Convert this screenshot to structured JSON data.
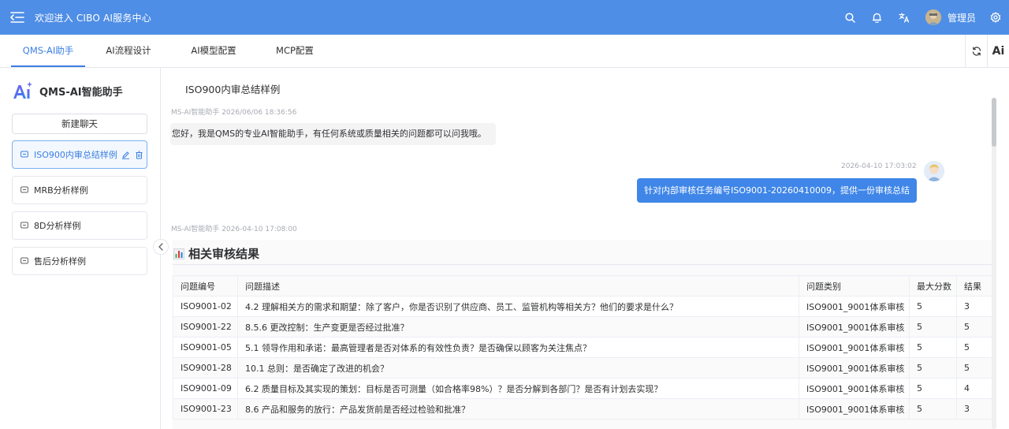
{
  "header": {
    "title": "欢迎进入 CIBO AI服务中心",
    "username": "管理员",
    "icons": [
      "menu-fold-icon",
      "search-icon",
      "bell-icon",
      "translate-icon",
      "avatar",
      "gear-icon"
    ],
    "bg_color": "#4f8ee6"
  },
  "tabs": [
    {
      "label": "QMS-AI助手",
      "active": true
    },
    {
      "label": "AI流程设计",
      "active": false
    },
    {
      "label": "AI模型配置",
      "active": false
    },
    {
      "label": "MCP配置",
      "active": false
    }
  ],
  "tab_tools": {
    "refresh_icon": "refresh-icon",
    "ai_label": "Ai"
  },
  "sidebar": {
    "brand": "QMS-AI智能助手",
    "logo_text": "Ai",
    "new_chat": "新建聊天",
    "sessions": [
      {
        "label": "ISO900内审总结样例",
        "active": true
      },
      {
        "label": "MRB分析样例",
        "active": false
      },
      {
        "label": "8D分析样例",
        "active": false
      },
      {
        "label": "售后分析样例",
        "active": false
      }
    ]
  },
  "chat": {
    "title": "ISO900内审总结样例",
    "messages": [
      {
        "role": "assistant",
        "meta": "MS-AI智能助手   2026/06/06 18:36:56",
        "text": "您好，我是QMS的专业AI智能助手，有任何系统或质量相关的问题都可以问我哦。"
      },
      {
        "role": "user",
        "meta": "2026-04-10 17:03:02",
        "text": "针对内部审核任务编号ISO9001-20260410009，提供一份审核总结"
      },
      {
        "role": "assistant",
        "meta": "MS-AI智能助手   2026-04-10 17:08:00"
      }
    ],
    "result_title": "相关审核结果",
    "table": {
      "headers": [
        "问题编号",
        "问题描述",
        "问题类别",
        "最大分数",
        "结果"
      ],
      "rows": [
        [
          "ISO9001-02",
          "4.2 理解相关方的需求和期望：除了客户，你是否识别了供应商、员工、监管机构等相关方？他们的要求是什么？",
          "ISO9001_9001体系审核",
          "5",
          "3"
        ],
        [
          "ISO9001-22",
          "8.5.6 更改控制：生产变更是否经过批准？",
          "ISO9001_9001体系审核",
          "5",
          "5"
        ],
        [
          "ISO9001-05",
          "5.1 领导作用和承诺：最高管理者是否对体系的有效性负责？是否确保以顾客为关注焦点？",
          "ISO9001_9001体系审核",
          "5",
          "5"
        ],
        [
          "ISO9001-28",
          "10.1 总则：是否确定了改进的机会？",
          "ISO9001_9001体系审核",
          "5",
          "5"
        ],
        [
          "ISO9001-09",
          "6.2 质量目标及其实现的策划：目标是否可测量（如合格率98%）？是否分解到各部门？是否有计划去实现？",
          "ISO9001_9001体系审核",
          "5",
          "4"
        ],
        [
          "ISO9001-23",
          "8.6 产品和服务的放行：产品发货前是否经过检验和批准？",
          "ISO9001_9001体系审核",
          "5",
          "3"
        ]
      ]
    }
  }
}
